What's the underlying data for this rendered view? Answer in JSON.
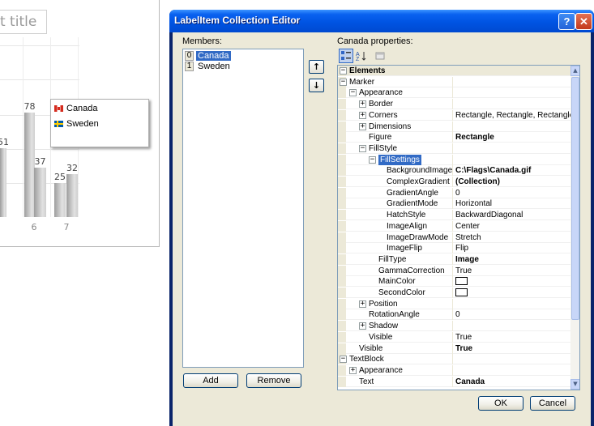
{
  "background_chart": {
    "title_fragment": "rt title",
    "bars": [
      {
        "value": 51,
        "label": "51"
      },
      {
        "value": 78,
        "label": "78"
      },
      {
        "value": 37,
        "label": "37"
      },
      {
        "value": 25,
        "label": "25"
      },
      {
        "value": 32,
        "label": "32"
      }
    ],
    "x_ticks": [
      "6",
      "7"
    ],
    "legend": [
      {
        "label": "Canada",
        "flag": "canada-flag-icon"
      },
      {
        "label": "Sweden",
        "flag": "sweden-flag-icon"
      }
    ]
  },
  "dialog": {
    "title": "LabelItem Collection Editor",
    "help_label": "?",
    "close_label": "✕",
    "members_label": "Members:",
    "members": [
      {
        "index": "0",
        "name": "Canada",
        "selected": true
      },
      {
        "index": "1",
        "name": "Sweden",
        "selected": false
      }
    ],
    "move_up_label": "↑",
    "move_down_label": "↓",
    "add_label": "Add",
    "remove_label": "Remove",
    "properties_label": "Canada properties:",
    "ok_label": "OK",
    "cancel_label": "Cancel",
    "properties": [
      {
        "name": "Elements",
        "value": "",
        "level": 0,
        "type": "cat",
        "expander": "−"
      },
      {
        "name": "Marker",
        "value": "",
        "level": 0,
        "expander": "−"
      },
      {
        "name": "Appearance",
        "value": "",
        "level": 1,
        "expander": "−"
      },
      {
        "name": "Border",
        "value": "",
        "level": 2,
        "expander": "+"
      },
      {
        "name": "Corners",
        "value": "Rectangle, Rectangle, Rectangle, Rec",
        "level": 2,
        "expander": "+"
      },
      {
        "name": "Dimensions",
        "value": "",
        "level": 2,
        "expander": "+"
      },
      {
        "name": "Figure",
        "value": "Rectangle",
        "level": 2,
        "bold": true
      },
      {
        "name": "FillStyle",
        "value": "",
        "level": 2,
        "expander": "−"
      },
      {
        "name": "FillSettings",
        "value": "",
        "level": 3,
        "expander": "−",
        "selected": true
      },
      {
        "name": "BackgroundImage",
        "value": "C:\\Flags\\Canada.gif",
        "level": 4,
        "bold": true
      },
      {
        "name": "ComplexGradient",
        "value": "(Collection)",
        "level": 4,
        "bold": true
      },
      {
        "name": "GradientAngle",
        "value": "0",
        "level": 4
      },
      {
        "name": "GradientMode",
        "value": "Horizontal",
        "level": 4
      },
      {
        "name": "HatchStyle",
        "value": "BackwardDiagonal",
        "level": 4
      },
      {
        "name": "ImageAlign",
        "value": "Center",
        "level": 4
      },
      {
        "name": "ImageDrawMode",
        "value": "Stretch",
        "level": 4
      },
      {
        "name": "ImageFlip",
        "value": "Flip",
        "level": 4
      },
      {
        "name": "FillType",
        "value": "Image",
        "level": 3,
        "bold": true
      },
      {
        "name": "GammaCorrection",
        "value": "True",
        "level": 3
      },
      {
        "name": "MainColor",
        "value": "",
        "level": 3,
        "swatch": true
      },
      {
        "name": "SecondColor",
        "value": "",
        "level": 3,
        "swatch": true
      },
      {
        "name": "Position",
        "value": "",
        "level": 2,
        "expander": "+"
      },
      {
        "name": "RotationAngle",
        "value": "0",
        "level": 2
      },
      {
        "name": "Shadow",
        "value": "",
        "level": 2,
        "expander": "+"
      },
      {
        "name": "Visible",
        "value": "True",
        "level": 2
      },
      {
        "name": "Visible",
        "value": "True",
        "level": 1,
        "bold": true
      },
      {
        "name": "TextBlock",
        "value": "",
        "level": 0,
        "expander": "−"
      },
      {
        "name": "Appearance",
        "value": "",
        "level": 1,
        "expander": "+"
      },
      {
        "name": "Text",
        "value": "Canada",
        "level": 1,
        "bold": true
      }
    ]
  }
}
